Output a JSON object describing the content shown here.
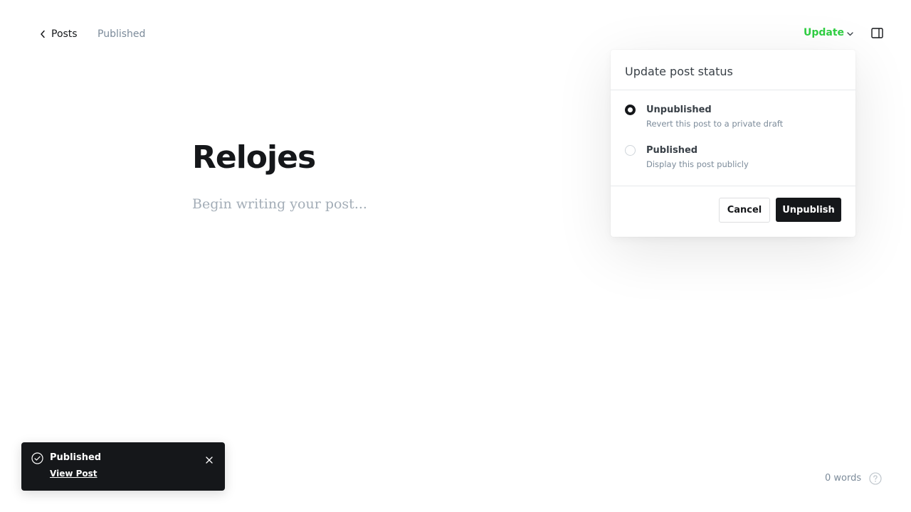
{
  "header": {
    "back_label": "Posts",
    "status": "Published",
    "update_label": "Update"
  },
  "editor": {
    "title": "Relojes",
    "body_placeholder": "Begin writing your post..."
  },
  "popover": {
    "title": "Update post status",
    "options": [
      {
        "label": "Unpublished",
        "description": "Revert this post to a private draft",
        "selected": true
      },
      {
        "label": "Published",
        "description": "Display this post publicly",
        "selected": false
      }
    ],
    "cancel_label": "Cancel",
    "confirm_label": "Unpublish"
  },
  "toast": {
    "title": "Published",
    "link_label": "View Post"
  },
  "footer": {
    "word_count": "0 words"
  },
  "colors": {
    "accent_green": "#30cf43",
    "dark": "#15171a",
    "muted": "#7c8b9a"
  },
  "icons": {
    "back": "chevron-left-icon",
    "update_caret": "chevron-down-icon",
    "sidebar": "sidebar-panel-icon",
    "toast_check": "check-circle-icon",
    "toast_close": "close-icon",
    "help": "question-circle-icon"
  }
}
